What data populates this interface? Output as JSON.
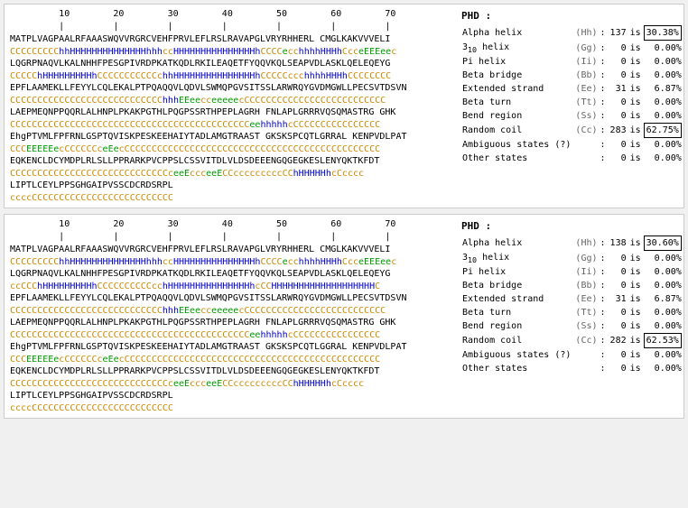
{
  "panels": [
    {
      "id": "panel1",
      "ruler": "         10        20        30        40        50        60        70",
      "ruler_ticks": "         |         |         |         |         |         |         |",
      "sequence_lines": [
        {
          "text": "MATPLVAGPAALRFAAASWQVVRGRCVEHFPRVLEFLRSLRAVAPGLVRYRHHERL CMGLKAKVVVELI",
          "colors": "normal"
        },
        {
          "text": "CCCCCCCCChhHHHHHHHHHHHHHHhhhccHHHHHHHHHHHHHHHhCCCCecchhhhHHHhCcceEEEeec",
          "type": "coded"
        },
        {
          "text": "LQGRPNAQVLKALNHHFPESGPIVRDPKATKQDLRKILEAQETFYQQVKQLSEAPVDLASKLQELEQEYG",
          "colors": "normal"
        },
        {
          "text": "CCCCChHHHHHHHHHhCCCCCCCCCCCchhHHHHHHHHHHHHHHHhCCCCCccchhhhHHHhCCCCCCCC",
          "type": "coded"
        },
        {
          "text": "EPFLAAMEKLLFEYYLCQLEKALPTPQAQQVLQDVLSWMQPGVSITSSLARWRQYGVDMGWLLPECSVTDSVN",
          "colors": "normal"
        },
        {
          "text": "CCCCCCCCCCCCCCCCCCCCCCCCCCCChhhEEeecceeeeecCCCCCCCCCCCCCCCCCCCCCCCCCC",
          "type": "coded"
        },
        {
          "text": "LAEPMEQNPPQQRLALHNPLPKAKPGTHLPQGPSSRTHPEPLAGRH FNLAPLGRRRVQSQMASTRG GHK",
          "colors": "normal"
        },
        {
          "text": "CCCCCCCCCCCCCCCCCCCCCCCCCCCCCCCCCCCCCCCCCCCCeehhhhhcCCCCCCCCCCCCCCCC",
          "type": "coded"
        },
        {
          "text": "EhgPTVMLFPFRNLGSPTQVISKPESKEEHAIYTADLAMGTRAAST GKSKSPCQTLGRRAL KENPVDLPAT",
          "colors": "normal"
        },
        {
          "text": "CCCEEEEEecCCCCCCceEecCCCCCCCCCCCCCCCCCCCCCCCCCCCCCCCCCCCCCCCCCCCCCCC",
          "type": "coded"
        },
        {
          "text": "EQKENCLDCYMDPLRLSLLPPRARKPVCPPSLCSSVITDLVLDSDEEENGQGEGKESLENYQKTKFDT",
          "colors": "normal"
        },
        {
          "text": "CCCCCCCCCCCCCCCCCCCCCCCCCCCCCceeEccceeECCcccccccccCChHHHHHhcCcccc",
          "type": "coded"
        },
        {
          "text": "LIPTLCEYLPPSGHGAIPVSSCDCRDSRPL",
          "colors": "normal"
        },
        {
          "text": "ccccCCCCCCCCCCCCCCCCCCCCCCCCCC",
          "type": "coded"
        }
      ],
      "phd": {
        "title": "PHD :",
        "rows": [
          {
            "label": "Alpha helix",
            "code": "(Hh)",
            "value": "137",
            "is": "is",
            "pct": "30.38%",
            "highlight": true
          },
          {
            "label": "3₁₀ helix",
            "code": "(Gg)",
            "value": "0",
            "is": "is",
            "pct": "0.00%",
            "highlight": false
          },
          {
            "label": "Pi helix",
            "code": "(Ii)",
            "value": "0",
            "is": "is",
            "pct": "0.00%",
            "highlight": false
          },
          {
            "label": "Beta bridge",
            "code": "(Bb)",
            "value": "0",
            "is": "is",
            "pct": "0.00%",
            "highlight": false
          },
          {
            "label": "Extended strand",
            "code": "(Ee)",
            "value": "31",
            "is": "is",
            "pct": "6.87%",
            "highlight": false
          },
          {
            "label": "Beta turn",
            "code": "(Tt)",
            "value": "0",
            "is": "is",
            "pct": "0.00%",
            "highlight": false
          },
          {
            "label": "Bend region",
            "code": "(Ss)",
            "value": "0",
            "is": "is",
            "pct": "0.00%",
            "highlight": false
          },
          {
            "label": "Random coil",
            "code": "(Cc)",
            "value": "283",
            "is": "is",
            "pct": "62.75%",
            "highlight": true
          },
          {
            "label": "Ambiguous states (?)",
            "code": "",
            "value": "0",
            "is": "is",
            "pct": "0.00%",
            "highlight": false
          },
          {
            "label": "Other states",
            "code": "",
            "value": "0",
            "is": "is",
            "pct": "0.00%",
            "highlight": false
          }
        ]
      }
    },
    {
      "id": "panel2",
      "ruler": "         10        20        30        40        50        60        70",
      "ruler_ticks": "         |         |         |         |         |         |         |",
      "sequence_lines": [
        {
          "text": "MATPLVAGPAALRFAAASWQVVRGRCVEHFPRVLEFLRSLRAVAPGLVRYRHHERL CMGLKAKVVVELI",
          "colors": "normal"
        },
        {
          "text": "CCCCCCCCChhHHHHHHHHHHHHHHhhhccHHHHHHHHHHHHHHHhCCCCecchhhhHHHhCcceEEEeec",
          "type": "coded"
        },
        {
          "text": "LQGRPNAQVLKALNHHFPESGPIVRDPKATKQDLRKILEAQETFYQQVKQLSEAPVDLASKLQELEQEYG",
          "colors": "normal"
        },
        {
          "text": "ccCCChHHHHHHHHHhCCCCCCCCCCcchHHHHHHHHHHHHHHHhcCCHHHHHHHHHHHHHHHHHHHC",
          "type": "coded"
        },
        {
          "text": "EPFLAAMEKLLFEYYLCQLEKALPTPQAQQVLQDVLSWMQPGVSITSSLARWRQYGVDMGWLLPECSVTDSVN",
          "colors": "normal"
        },
        {
          "text": "CCCCCCCCCCCCCCCCCCCCCCCCCCCChhhEEeecceeeeecCCCCCCCCCCCCCCCCCCCCCCCCCC",
          "type": "coded"
        },
        {
          "text": "LAEPMEQNPPQQRLALHNPLPKAKPGTHLPQGPSSRTHPEPLAGRH FNLAPLGRRRVQSQMASTRG GHK",
          "colors": "normal"
        },
        {
          "text": "CCCCCCCCCCCCCCCCCCCCCCCCCCCCCCCCCCCCCCCCCCCCeehhhhhcCCCCCCCCCCCCCCCC",
          "type": "coded"
        },
        {
          "text": "EhgPTVMLFPFRNLGSPTQVISKPESKEEHAIYTADLAMGTRAAST GKSKSPCQTLGGRAL KENPVDLPAT",
          "colors": "normal"
        },
        {
          "text": "CCCEEEEEecCCCCCCceEecCCCCCCCCCCCCCCCCCCCCCCCCCCCCCCCCCCCCCCCCCCCCCCC",
          "type": "coded"
        },
        {
          "text": "EQKENCLDCYMDPLRLSLLPPRARKPVCPPSLCSSVITDLVLDSDEEENGQGEGKESLENYQKTKFDT",
          "colors": "normal"
        },
        {
          "text": "CCCCCCCCCCCCCCCCCCCCCCCCCCCCCceeEccceeECCcccccccccCChHHHHHhcCcccc",
          "type": "coded"
        },
        {
          "text": "LIPTLCEYLPPSGHGAIPVSSCDCRDSRPL",
          "colors": "normal"
        },
        {
          "text": "ccccCCCCCCCCCCCCCCCCCCCCCCCCCC",
          "type": "coded"
        }
      ],
      "phd": {
        "title": "PHD :",
        "rows": [
          {
            "label": "Alpha helix",
            "code": "(Hh)",
            "value": "138",
            "is": "is",
            "pct": "30.60%",
            "highlight": true
          },
          {
            "label": "3₁₀ helix",
            "code": "(Gg)",
            "value": "0",
            "is": "is",
            "pct": "0.00%",
            "highlight": false
          },
          {
            "label": "Pi helix",
            "code": "(Ii)",
            "value": "0",
            "is": "is",
            "pct": "0.00%",
            "highlight": false
          },
          {
            "label": "Beta bridge",
            "code": "(Bb)",
            "value": "0",
            "is": "is",
            "pct": "0.00%",
            "highlight": false
          },
          {
            "label": "Extended strand",
            "code": "(Ee)",
            "value": "31",
            "is": "is",
            "pct": "6.87%",
            "highlight": false
          },
          {
            "label": "Beta turn",
            "code": "(Tt)",
            "value": "0",
            "is": "is",
            "pct": "0.00%",
            "highlight": false
          },
          {
            "label": "Bend region",
            "code": "(Ss)",
            "value": "0",
            "is": "is",
            "pct": "0.00%",
            "highlight": false
          },
          {
            "label": "Random coil",
            "code": "(Cc)",
            "value": "282",
            "is": "is",
            "pct": "62.53%",
            "highlight": true
          },
          {
            "label": "Ambiguous states (?)",
            "code": "",
            "value": "0",
            "is": "is",
            "pct": "0.00%",
            "highlight": false
          },
          {
            "label": "Other states",
            "code": "",
            "value": "0",
            "is": "is",
            "pct": "0.00%",
            "highlight": false
          }
        ]
      }
    }
  ]
}
